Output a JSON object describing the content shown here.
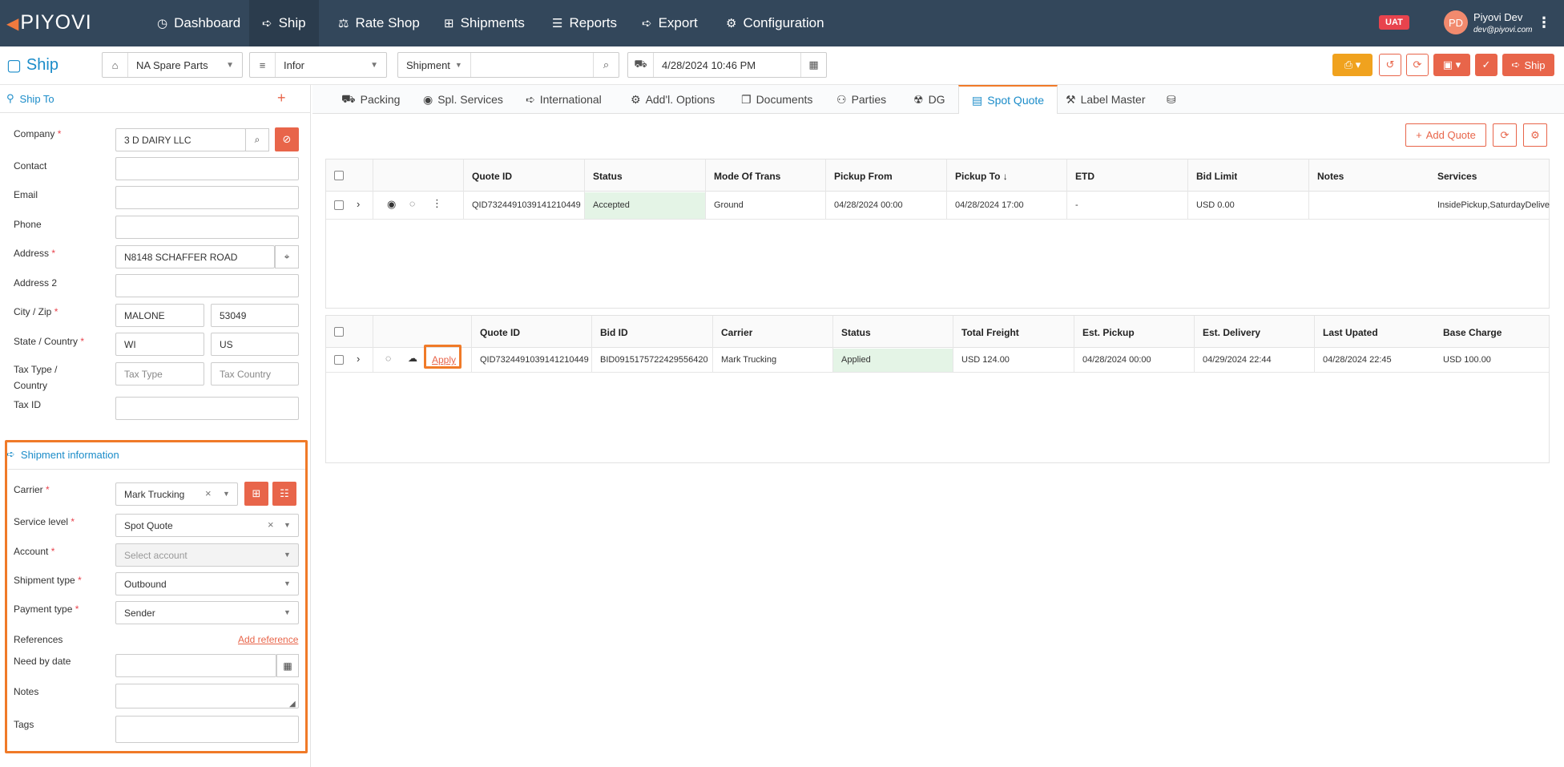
{
  "nav": {
    "logo": "PIYOVI",
    "items": [
      {
        "label": "Dashboard",
        "icon": "dashboard-icon"
      },
      {
        "label": "Ship",
        "icon": "send-icon"
      },
      {
        "label": "Rate Shop",
        "icon": "scale-icon"
      },
      {
        "label": "Shipments",
        "icon": "boxes-icon"
      },
      {
        "label": "Reports",
        "icon": "chart-icon"
      },
      {
        "label": "Export",
        "icon": "export-icon"
      },
      {
        "label": "Configuration",
        "icon": "gear-icon"
      }
    ],
    "env_badge": "UAT",
    "user": {
      "initials": "PD",
      "name": "Piyovi Dev",
      "email": "dev@piyovi.com"
    }
  },
  "toolbar": {
    "title": "Ship",
    "location": "NA Spare Parts",
    "system": "Infor",
    "search_type": "Shipment",
    "search_value": "",
    "date": "4/28/2024 10:46 PM",
    "ship_label": "Ship"
  },
  "ship_to": {
    "header": "Ship To",
    "company_label": "Company",
    "company": "3 D DAIRY LLC",
    "contact_label": "Contact",
    "contact": "",
    "email_label": "Email",
    "email": "",
    "phone_label": "Phone",
    "phone": "",
    "address_label": "Address",
    "address": "N8148 SCHAFFER ROAD",
    "address2_label": "Address 2",
    "address2": "",
    "cityzip_label": "City / Zip",
    "city": "MALONE",
    "zip": "53049",
    "statecountry_label": "State / Country",
    "state": "WI",
    "country": "US",
    "taxtype_label_1": "Tax Type /",
    "taxtype_label_2": "Country",
    "taxtype_placeholder": "Tax Type",
    "taxcountry_placeholder": "Tax Country",
    "taxid_label": "Tax ID",
    "taxid": ""
  },
  "shipment_info": {
    "header": "Shipment information",
    "carrier_label": "Carrier",
    "carrier": "Mark Trucking",
    "service_label": "Service level",
    "service": "Spot Quote",
    "account_label": "Account",
    "account_placeholder": "Select account",
    "shiptype_label": "Shipment type",
    "shiptype": "Outbound",
    "paytype_label": "Payment type",
    "paytype": "Sender",
    "references_label": "References",
    "add_reference": "Add reference",
    "needby_label": "Need by date",
    "needby": "",
    "notes_label": "Notes",
    "tags_label": "Tags"
  },
  "tabs": [
    {
      "label": "Packing",
      "icon": "truck-icon"
    },
    {
      "label": "Spl. Services",
      "icon": "toggle-icon"
    },
    {
      "label": "International",
      "icon": "plane-icon"
    },
    {
      "label": "Add'l. Options",
      "icon": "settings-icon"
    },
    {
      "label": "Documents",
      "icon": "documents-icon"
    },
    {
      "label": "Parties",
      "icon": "users-icon"
    },
    {
      "label": "DG",
      "icon": "hazard-icon"
    },
    {
      "label": "Spot Quote",
      "icon": "quote-icon"
    },
    {
      "label": "Label Master",
      "icon": "wrench-icon"
    },
    {
      "label": "",
      "icon": "database-icon"
    }
  ],
  "quote_actions": {
    "add_quote": "Add Quote"
  },
  "quotes_table": {
    "headers": [
      "Quote ID",
      "Status",
      "Mode Of Trans",
      "Pickup From",
      "Pickup To",
      "ETD",
      "Bid Limit",
      "Notes",
      "Services"
    ],
    "rows": [
      {
        "quote_id": "QID7324491039141210449",
        "status": "Accepted",
        "mode": "Ground",
        "pickup_from": "04/28/2024 00:00",
        "pickup_to": "04/28/2024 17:00",
        "etd": "-",
        "bid_limit": "USD 0.00",
        "notes": "",
        "services": "InsidePickup,SaturdayDelive"
      }
    ]
  },
  "bids_table": {
    "headers": [
      "Quote ID",
      "Bid ID",
      "Carrier",
      "Status",
      "Total Freight",
      "Est. Pickup",
      "Est. Delivery",
      "Last Upated",
      "Base Charge"
    ],
    "rows": [
      {
        "apply": "Apply",
        "quote_id": "QID7324491039141210449",
        "bid_id": "BID0915175722429556420",
        "carrier": "Mark Trucking",
        "status": "Applied",
        "total_freight": "USD 124.00",
        "est_pickup": "04/28/2024 00:00",
        "est_delivery": "04/29/2024 22:44",
        "last_updated": "04/28/2024 22:45",
        "base_charge": "USD 100.00"
      }
    ]
  },
  "colors": {
    "nav_bg": "#33475b",
    "accent_blue": "#1b8cc9",
    "accent_red": "#e8654a",
    "highlight": "#f07a28",
    "status_green": "#e4f4e6"
  }
}
